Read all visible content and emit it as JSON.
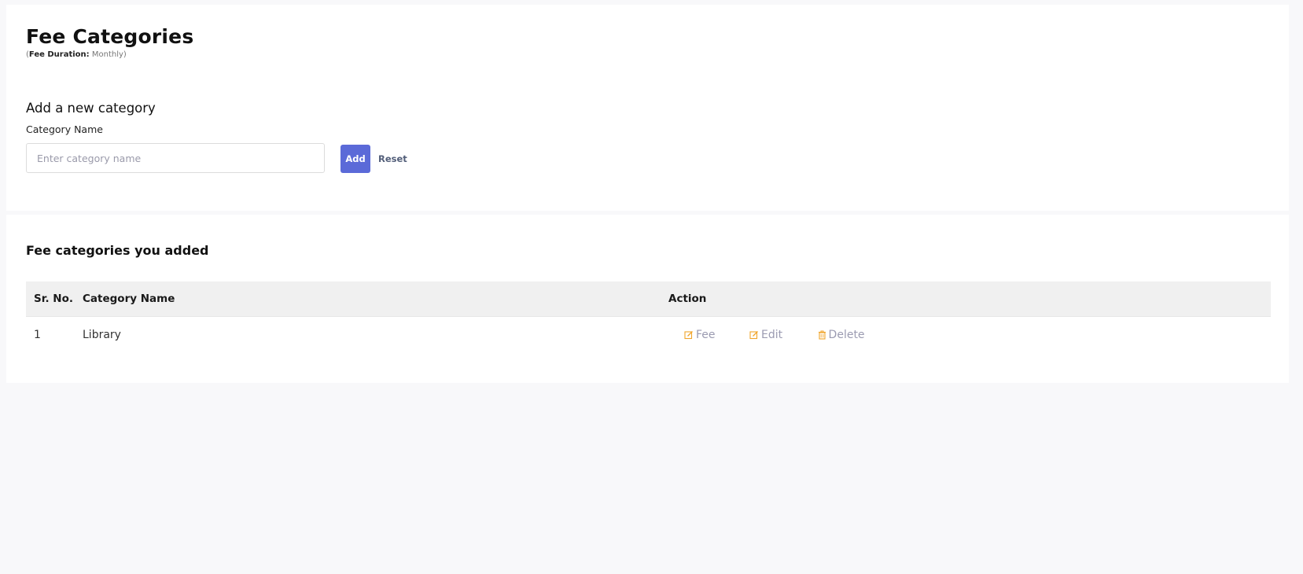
{
  "page": {
    "title": "Fee Categories",
    "duration_label": "Fee Duration:",
    "duration_value": "Monthly"
  },
  "form": {
    "section_title": "Add a new category",
    "field_label": "Category Name",
    "input_value": "",
    "input_placeholder": "Enter category name",
    "add_label": "Add",
    "reset_label": "Reset"
  },
  "list": {
    "title": "Fee categories you added",
    "columns": [
      "Sr. No.",
      "Category Name",
      "Action"
    ],
    "rows": [
      {
        "sr": "1",
        "name": "Library"
      }
    ],
    "actions": {
      "fee": "Fee",
      "edit": "Edit",
      "delete": "Delete"
    }
  },
  "icons": {
    "fee": "edit-square-icon",
    "edit": "edit-square-icon",
    "delete": "trash-icon"
  },
  "colors": {
    "primary": "#5b6ad8",
    "action_icon": "#f0a52c",
    "action_text": "#9b9bb1",
    "background": "#f8f8fa"
  }
}
